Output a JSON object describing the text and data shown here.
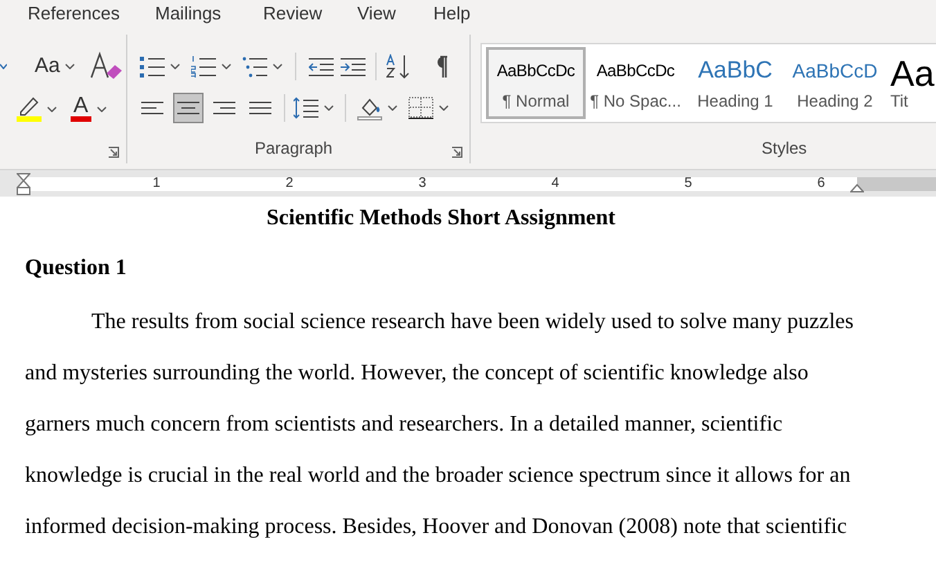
{
  "tabs": [
    {
      "label": "References"
    },
    {
      "label": "Mailings"
    },
    {
      "label": "Review"
    },
    {
      "label": "View"
    },
    {
      "label": "Help"
    }
  ],
  "font_group": {
    "change_case": "Aa",
    "font_color": "A"
  },
  "paragraph_group": {
    "label": "Paragraph",
    "alignment": [
      {
        "kind": "left",
        "selected": false
      },
      {
        "kind": "center",
        "selected": true
      },
      {
        "kind": "right",
        "selected": false
      },
      {
        "kind": "justify",
        "selected": false
      }
    ]
  },
  "styles_group": {
    "label": "Styles",
    "styles": [
      {
        "preview": "AaBbCcDc",
        "name": "¶ Normal",
        "kind": "body",
        "selected": true
      },
      {
        "preview": "AaBbCcDc",
        "name": "¶ No Spac...",
        "kind": "body",
        "selected": false
      },
      {
        "preview": "AaBbC",
        "name": "Heading 1",
        "kind": "heading1",
        "selected": false
      },
      {
        "preview": "AaBbCcD",
        "name": "Heading 2",
        "kind": "heading2",
        "selected": false
      },
      {
        "preview": "Aa",
        "name": "Tit",
        "kind": "title",
        "selected": false
      }
    ]
  },
  "ruler": {
    "labels": [
      "1",
      "2",
      "3",
      "4",
      "5",
      "6"
    ]
  },
  "document": {
    "title": "Scientific Methods Short Assignment",
    "heading": "Question 1",
    "paragraphs": [
      "The results from social science research have been widely used to solve many puzzles and mysteries surrounding the world. However, the concept of scientific knowledge also garners much concern from scientists and researchers. In a detailed manner, scientific knowledge is crucial in the real world and the broader science spectrum since it allows for an informed decision-making process. Besides, Hoover and Donovan (2008) note that scientific"
    ]
  }
}
